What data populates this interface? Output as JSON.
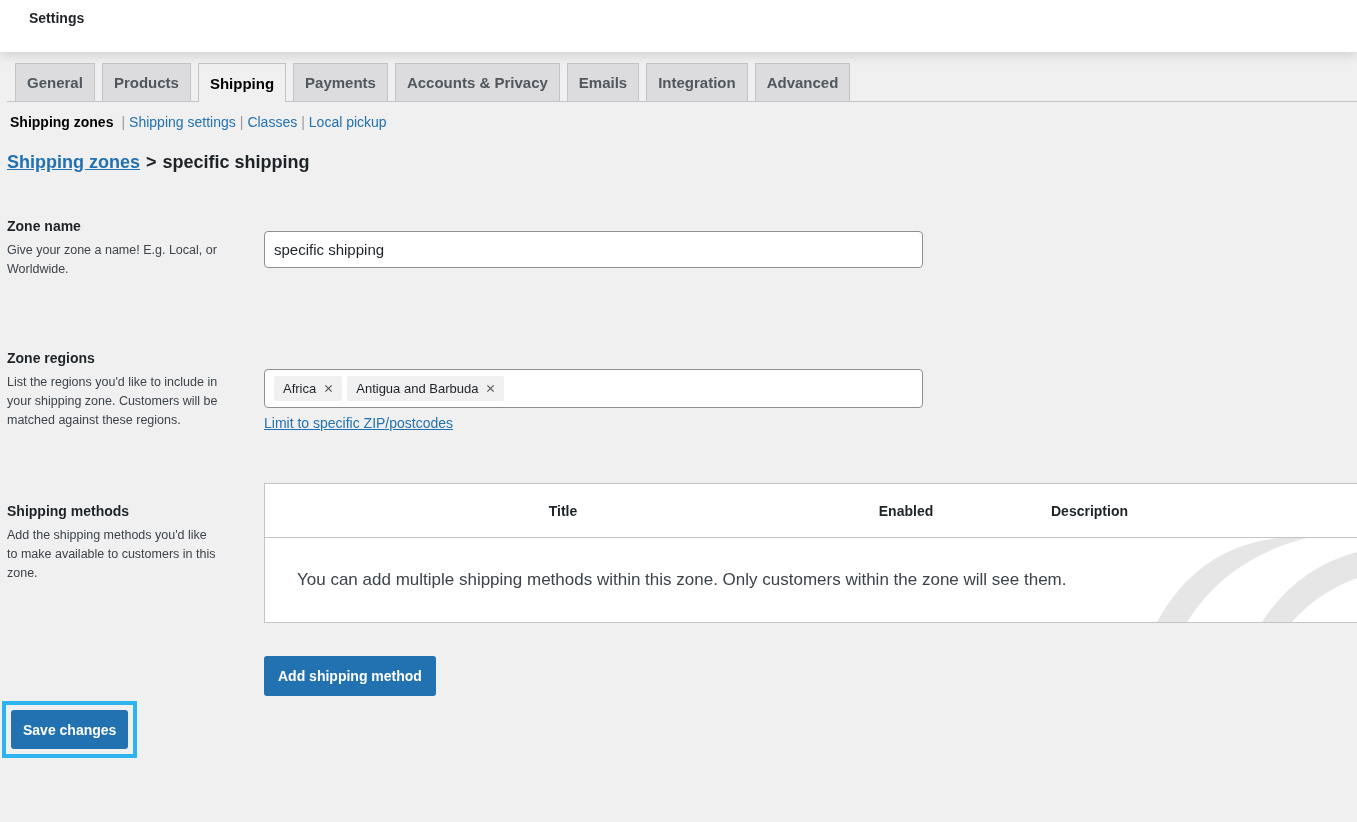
{
  "header": {
    "title": "Settings"
  },
  "tabs": [
    {
      "label": "General",
      "selected": false
    },
    {
      "label": "Products",
      "selected": false
    },
    {
      "label": "Shipping",
      "selected": true
    },
    {
      "label": "Payments",
      "selected": false
    },
    {
      "label": "Accounts & Privacy",
      "selected": false
    },
    {
      "label": "Emails",
      "selected": false
    },
    {
      "label": "Integration",
      "selected": false
    },
    {
      "label": "Advanced",
      "selected": false
    }
  ],
  "sublinks": [
    {
      "label": "Shipping zones",
      "selected": true
    },
    {
      "separator": "|",
      "label": "Shipping settings",
      "selected": false
    },
    {
      "separator": "|",
      "label": "Classes",
      "selected": false
    },
    {
      "separator": "|",
      "label": "Local pickup",
      "selected": false
    }
  ],
  "breadcrumb": {
    "link": "Shipping zones",
    "separator": ">",
    "current": "specific shipping"
  },
  "zone_name": {
    "label": "Zone name",
    "help": "Give your zone a name! E.g. Local, or Worldwide.",
    "value": "specific shipping"
  },
  "zone_regions": {
    "label": "Zone regions",
    "help": "List the regions you'd like to include in your shipping zone. Customers will be matched against these regions.",
    "tags": [
      "Africa",
      "Antigua and Barbuda"
    ],
    "link": "Limit to specific ZIP/postcodes"
  },
  "shipping_methods": {
    "label": "Shipping methods",
    "help": "Add the shipping methods you'd like to make available to customers in this zone.",
    "columns": [
      "Title",
      "Enabled",
      "Description"
    ],
    "empty_message": "You can add multiple shipping methods within this zone. Only customers within the zone will see them.",
    "add_button": "Add shipping method"
  },
  "save_button": {
    "label": "Save changes",
    "highlighted": true
  }
}
